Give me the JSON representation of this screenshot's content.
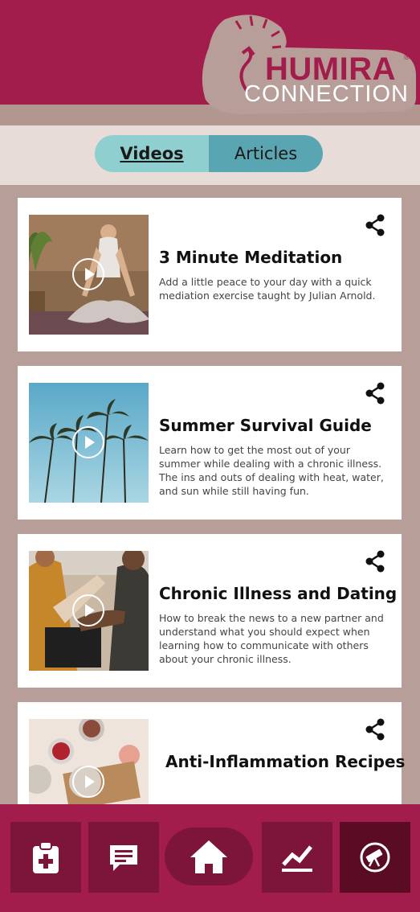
{
  "brand": {
    "name_line1": "HUMIRA",
    "registered": "®",
    "name_line2": "CONNECTION",
    "primary_color": "#a21c4c",
    "accent_color": "#8fcfcf"
  },
  "tabs": [
    {
      "label": "Videos",
      "active": true
    },
    {
      "label": "Articles",
      "active": false
    }
  ],
  "cards": [
    {
      "title": "3 Minute Meditation",
      "description": "Add a little peace to your day with a quick mediation exercise taught by Julian Arnold.",
      "thumbnail": "meditation-woman-image"
    },
    {
      "title": "Summer Survival Guide",
      "description": "Learn how to get the most out of your summer while dealing with a chronic illness. The ins and outs of dealing with heat, water, and sun while still having fun.",
      "thumbnail": "palm-trees-image"
    },
    {
      "title": "Chronic Illness and Dating",
      "description": "How to break the news to a new partner and understand what you should expect when learning how to communicate with others about your chronic illness.",
      "thumbnail": "couple-hands-image"
    },
    {
      "title": "Anti-Inflammation Recipes",
      "description": "",
      "thumbnail": "food-bowls-image"
    }
  ],
  "bottom_nav": [
    {
      "icon": "clipboard-medical-icon"
    },
    {
      "icon": "chat-icon"
    },
    {
      "icon": "home-icon"
    },
    {
      "icon": "trend-chart-icon"
    },
    {
      "icon": "telescope-icon",
      "active": true
    }
  ]
}
